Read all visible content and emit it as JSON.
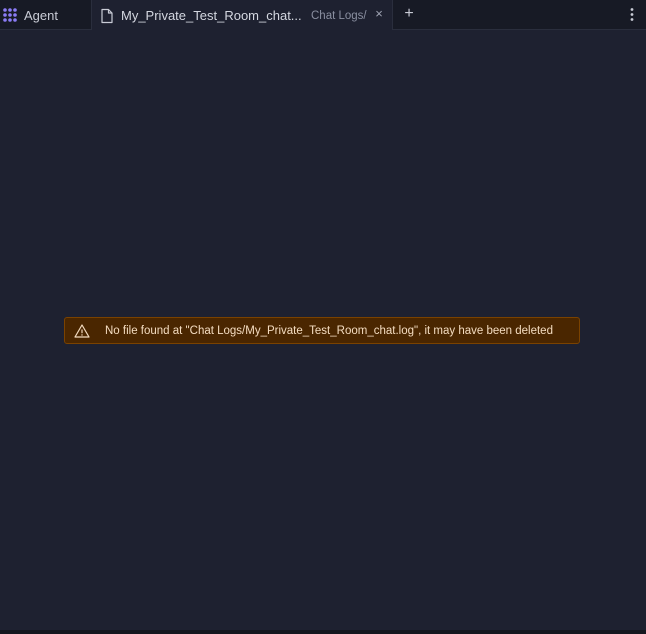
{
  "tabs": [
    {
      "label": "Agent",
      "icon": "agent-grid-icon",
      "active": false
    },
    {
      "label": "My_Private_Test_Room_chat...",
      "path": "Chat Logs/",
      "icon": "file-icon",
      "active": true,
      "close": "×"
    }
  ],
  "toolbar": {
    "new_tab": "+",
    "more": "more-vertical-icon"
  },
  "warning": {
    "icon": "warning-triangle-icon",
    "message": "No file found at \"Chat Logs/My_Private_Test_Room_chat.log\", it may have been deleted"
  },
  "colors": {
    "background": "#1e2130",
    "tabbar": "#171a25",
    "warning_bg": "#4a2600",
    "warning_border": "#7a4200",
    "agent_icon": "#8b7cf6"
  }
}
